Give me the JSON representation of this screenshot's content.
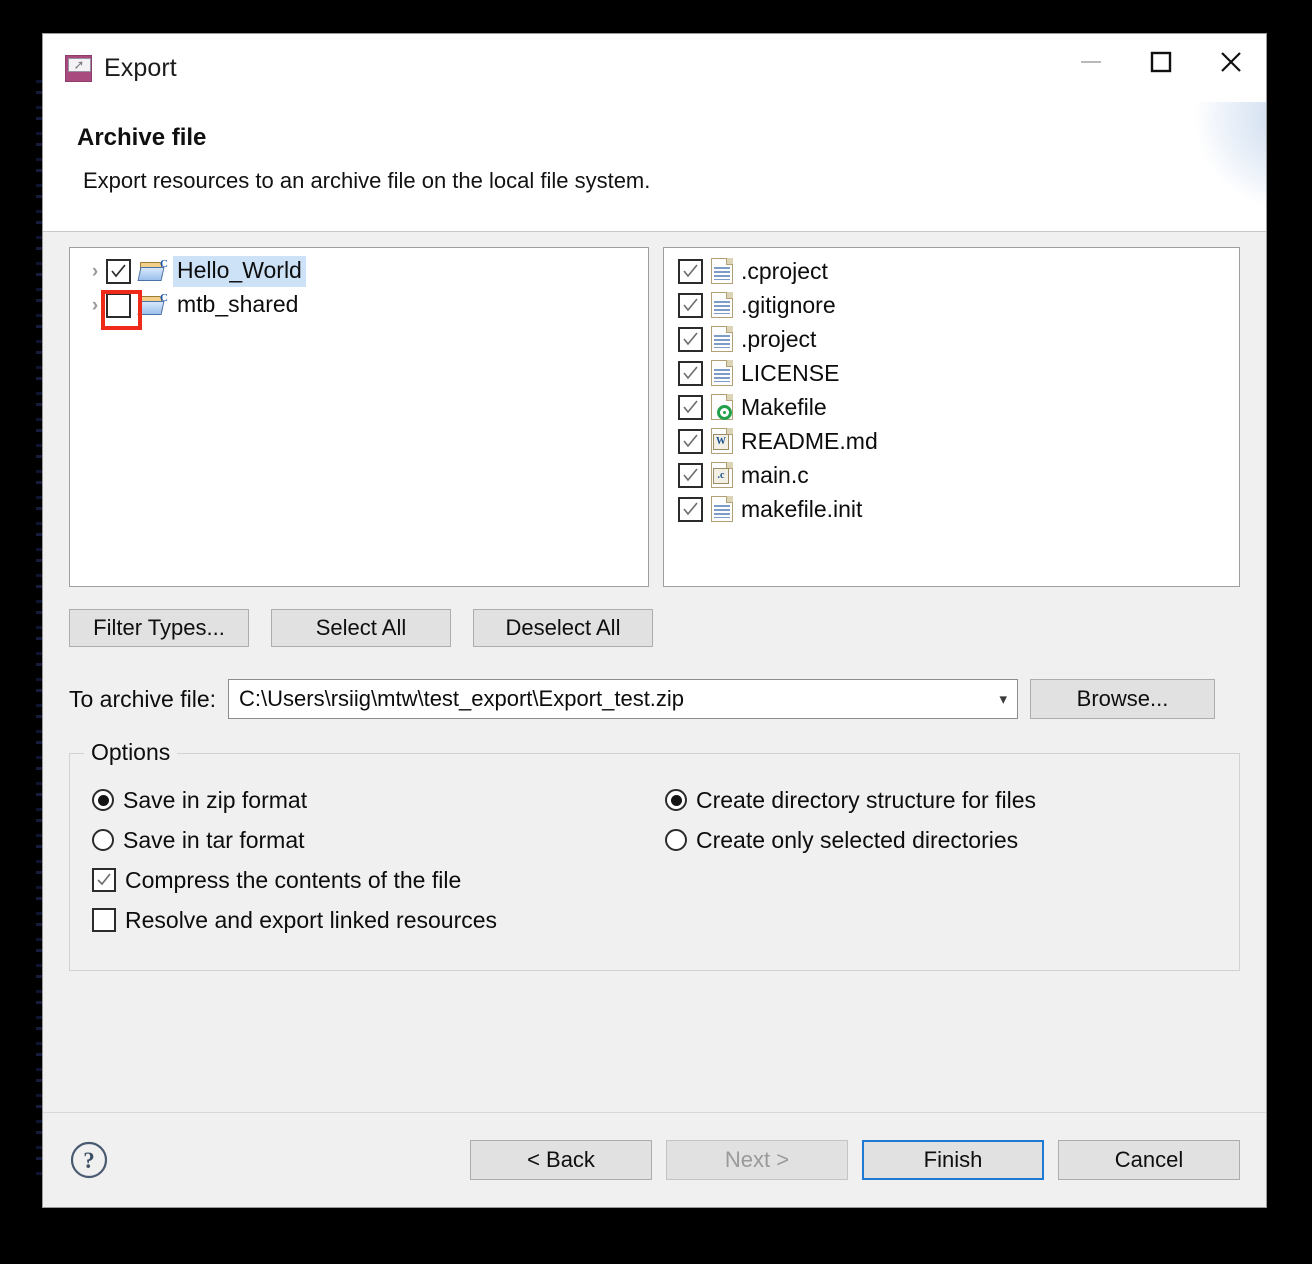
{
  "window": {
    "title": "Export",
    "icon": "export-icon",
    "controls": {
      "minimize": "minimize-icon",
      "maximize": "maximize-icon",
      "close": "close-icon"
    }
  },
  "banner": {
    "title": "Archive file",
    "description": "Export resources to an archive file on the local file system.",
    "art": "archive-clamp-document-icon"
  },
  "tree": {
    "items": [
      {
        "label": "Hello_World",
        "checked": true,
        "selected": true,
        "expandable": true,
        "icon": "c-project-folder-icon",
        "annotated": false
      },
      {
        "label": "mtb_shared",
        "checked": false,
        "selected": false,
        "expandable": true,
        "icon": "c-project-folder-icon",
        "annotated": true
      }
    ]
  },
  "files": {
    "items": [
      {
        "label": ".cproject",
        "checked": true,
        "icon": "file-icon",
        "badge": ""
      },
      {
        "label": ".gitignore",
        "checked": true,
        "icon": "file-icon",
        "badge": ""
      },
      {
        "label": ".project",
        "checked": true,
        "icon": "file-icon",
        "badge": ""
      },
      {
        "label": "LICENSE",
        "checked": true,
        "icon": "file-icon",
        "badge": ""
      },
      {
        "label": "Makefile",
        "checked": true,
        "icon": "makefile-gear-icon",
        "badge": ""
      },
      {
        "label": "README.md",
        "checked": true,
        "icon": "word-doc-icon",
        "badge": "W"
      },
      {
        "label": "main.c",
        "checked": true,
        "icon": "c-source-icon",
        "badge": ".c"
      },
      {
        "label": "makefile.init",
        "checked": true,
        "icon": "file-icon",
        "badge": ""
      }
    ]
  },
  "selection_buttons": {
    "filter_types": "Filter Types...",
    "select_all": "Select All",
    "deselect_all": "Deselect All"
  },
  "archive": {
    "label": "To archive file:",
    "value": "C:\\Users\\rsiig\\mtw\\test_export\\Export_test.zip",
    "placeholder": "",
    "dropdown_icon": "chevron-down-icon",
    "browse_button": "Browse..."
  },
  "options": {
    "legend": "Options",
    "left": [
      {
        "type": "radio",
        "label": "Save in zip format",
        "selected": true
      },
      {
        "type": "radio",
        "label": "Save in tar format",
        "selected": false
      },
      {
        "type": "checkbox",
        "label": "Compress the contents of the file",
        "checked": true
      },
      {
        "type": "checkbox",
        "label": "Resolve and export linked resources",
        "checked": false
      }
    ],
    "right": [
      {
        "type": "radio",
        "label": "Create directory structure for files",
        "selected": true
      },
      {
        "type": "radio",
        "label": "Create only selected directories",
        "selected": false
      }
    ]
  },
  "footer": {
    "help_icon": "help-question-icon",
    "back": "< Back",
    "next": "Next >",
    "finish": "Finish",
    "cancel": "Cancel",
    "next_disabled": true,
    "finish_is_default": true
  },
  "colors": {
    "dialog_bg": "#f0f0f0",
    "selection_highlight": "#cde2f7",
    "annotation_red": "#ee2a18",
    "default_button_border": "#1f7ad4",
    "title_icon_purple": "#a84a7e"
  }
}
